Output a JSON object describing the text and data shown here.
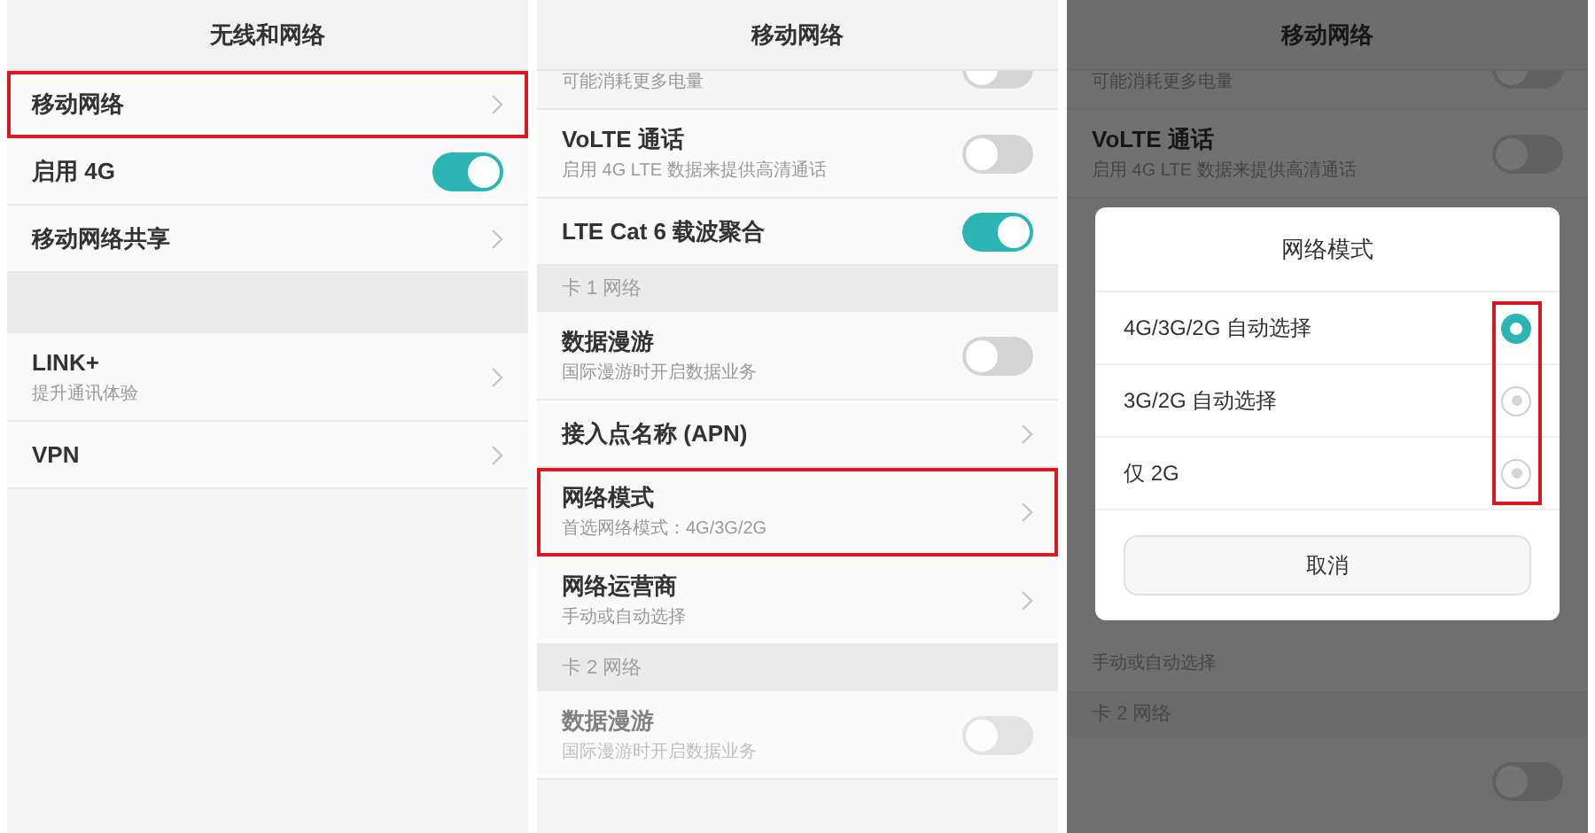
{
  "panels": [
    {
      "title": "无线和网络",
      "dimmed": false,
      "items": [
        {
          "kind": "link",
          "label": "移动网络",
          "highlighted": true
        },
        {
          "kind": "toggle",
          "label": "启用 4G",
          "on": true,
          "highlighted": false
        },
        {
          "kind": "link",
          "label": "移动网络共享",
          "highlighted": false
        },
        {
          "kind": "gap"
        },
        {
          "kind": "link",
          "label": "LINK+",
          "subtitle": "提升通讯体验",
          "highlighted": false
        },
        {
          "kind": "link",
          "label": "VPN",
          "highlighted": false
        }
      ]
    },
    {
      "title": "移动网络",
      "dimmed": false,
      "items": [
        {
          "kind": "toggle-tail",
          "subtitle": "可能消耗更多电量",
          "on": false
        },
        {
          "kind": "toggle",
          "label": "VoLTE 通话",
          "subtitle": "启用 4G LTE 数据来提供高清通话",
          "on": false,
          "highlighted": false,
          "disabled": false
        },
        {
          "kind": "toggle",
          "label": "LTE Cat 6 载波聚合",
          "on": true,
          "highlighted": false,
          "disabled": false
        },
        {
          "kind": "section",
          "label": "卡 1 网络"
        },
        {
          "kind": "toggle",
          "label": "数据漫游",
          "subtitle": "国际漫游时开启数据业务",
          "on": false,
          "highlighted": false,
          "disabled": false
        },
        {
          "kind": "link",
          "label": "接入点名称 (APN)",
          "highlighted": false,
          "disabled": false
        },
        {
          "kind": "link",
          "label": "网络模式",
          "subtitle": "首选网络模式：4G/3G/2G",
          "highlighted": true,
          "disabled": false
        },
        {
          "kind": "link",
          "label": "网络运营商",
          "subtitle": "手动或自动选择",
          "highlighted": false,
          "disabled": false
        },
        {
          "kind": "section",
          "label": "卡 2 网络"
        },
        {
          "kind": "toggle",
          "label": "数据漫游",
          "subtitle": "国际漫游时开启数据业务",
          "on": false,
          "highlighted": false,
          "disabled": true
        }
      ]
    },
    {
      "title": "移动网络",
      "dimmed": true,
      "items": [
        {
          "kind": "toggle-tail",
          "subtitle": "可能消耗更多电量",
          "on": false
        },
        {
          "kind": "toggle",
          "label": "VoLTE 通话",
          "subtitle": "启用 4G LTE 数据来提供高清通话",
          "on": false,
          "highlighted": false
        },
        {
          "kind": "covered"
        },
        {
          "kind": "text-tail",
          "subtitle": "手动或自动选择"
        },
        {
          "kind": "section",
          "label": "卡 2 网络"
        },
        {
          "kind": "toggle-only",
          "on": false
        }
      ],
      "dialog": {
        "title": "网络模式",
        "options_highlighted": true,
        "options": [
          {
            "label": "4G/3G/2G 自动选择",
            "selected": true
          },
          {
            "label": "3G/2G 自动选择",
            "selected": false
          },
          {
            "label": "仅 2G",
            "selected": false
          }
        ],
        "cancel": "取消"
      }
    }
  ]
}
